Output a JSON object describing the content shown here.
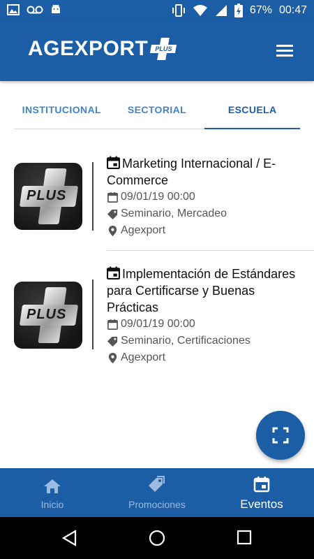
{
  "status_bar": {
    "battery": "67%",
    "time": "00:47"
  },
  "app_bar": {
    "brand": "AGEXPORT",
    "brand_badge": "PLUS"
  },
  "tabs": [
    {
      "label": "INSTITUCIONAL",
      "active": false
    },
    {
      "label": "SECTORIAL",
      "active": false
    },
    {
      "label": "ESCUELA",
      "active": true
    }
  ],
  "events": [
    {
      "thumb_text": "PLUS",
      "title": "Marketing Internacional / E-Commerce",
      "date": "09/01/19 00:00",
      "tags": "Seminario, Mercadeo",
      "location": "Agexport"
    },
    {
      "thumb_text": "PLUS",
      "title": "Implementación de Estándares para Certificarse y Buenas Prácticas",
      "date": "09/01/19 00:00",
      "tags": "Seminario, Certificaciones",
      "location": "Agexport"
    }
  ],
  "fab": {
    "icon": "fullscreen-icon"
  },
  "bottom_nav": [
    {
      "label": "Inicio",
      "icon": "home-icon",
      "active": false
    },
    {
      "label": "Promociones",
      "icon": "tag-icon",
      "active": false
    },
    {
      "label": "Eventos",
      "icon": "calendar-icon",
      "active": true
    }
  ],
  "colors": {
    "primary": "#1b5ea6",
    "tab_text": "#3f84c4",
    "inactive_nav": "#9bbbe0"
  }
}
